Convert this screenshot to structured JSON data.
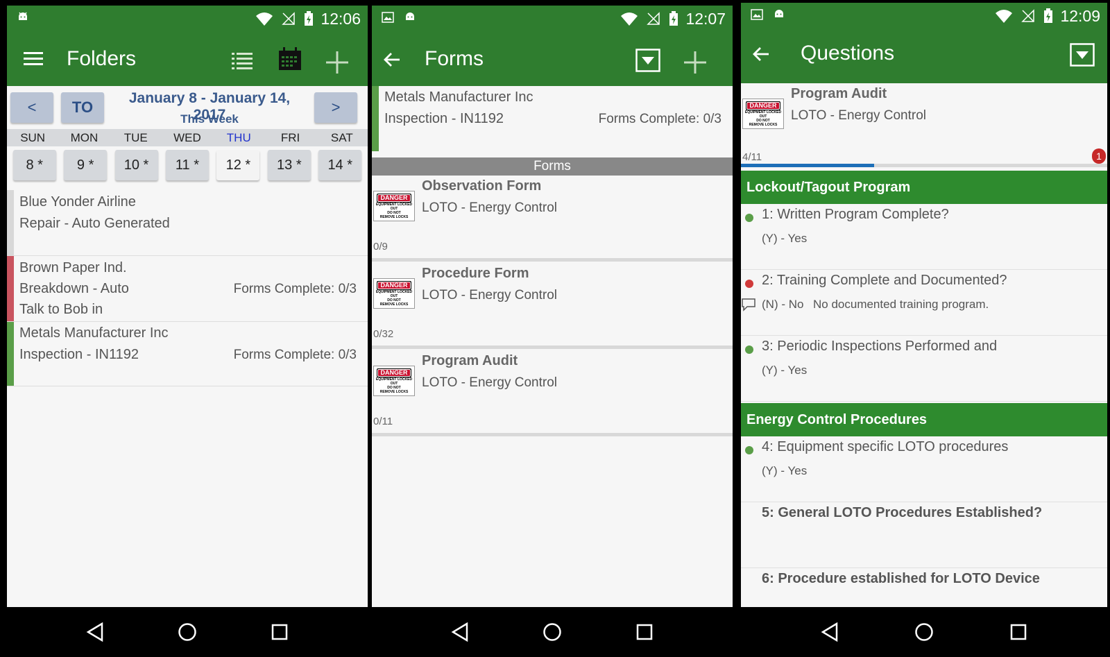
{
  "colors": {
    "primary": "#2f7d2f",
    "section": "#2e8b2e",
    "green_dot": "#5a9e48",
    "red_dot": "#d03a3a",
    "progress": "#1e6fb8"
  },
  "panel1": {
    "status_time": "12:06",
    "title": "Folders",
    "prev": "<",
    "today": "TO",
    "next": ">",
    "week_range": "January 8 - January 14, 2017",
    "week_label": "This Week",
    "days": [
      "SUN",
      "MON",
      "TUE",
      "WED",
      "THU",
      "FRI",
      "SAT"
    ],
    "dates": [
      "8 *",
      "9 *",
      "10 *",
      "11 *",
      "12 *",
      "13 *",
      "14 *"
    ],
    "folders": [
      {
        "line1": "Blue Yonder Airline",
        "line2": "Repair - Auto Generated",
        "line3": "",
        "right": ""
      },
      {
        "line1": "Brown Paper Ind.",
        "line2": "Breakdown - Auto",
        "line3": "Talk to Bob in",
        "right": "Forms Complete: 0/3"
      },
      {
        "line1": "Metals Manufacturer Inc",
        "line2": "Inspection - IN1192",
        "line3": "",
        "right": "Forms Complete: 0/3"
      }
    ]
  },
  "panel2": {
    "status_time": "12:07",
    "title": "Forms",
    "header_line1": "Metals Manufacturer Inc",
    "header_line2": "Inspection - IN1192",
    "header_right": "Forms Complete: 0/3",
    "section": "Forms",
    "forms": [
      {
        "title": "Observation Form",
        "sub": "LOTO - Energy Control",
        "count": "0/9"
      },
      {
        "title": "Procedure Form",
        "sub": "LOTO - Energy Control",
        "count": "0/32"
      },
      {
        "title": "Program Audit",
        "sub": "LOTO - Energy Control",
        "count": "0/11"
      }
    ],
    "danger_sign": {
      "badge": "DANGER",
      "line1": "EQUIPMENT LOCKED OUT",
      "line2": "DO NOT",
      "line3": "REMOVE LOCKS"
    }
  },
  "panel3": {
    "status_time": "12:09",
    "title": "Questions",
    "form_title": "Program Audit",
    "form_sub": "LOTO - Energy Control",
    "progress_label": "4/11",
    "progress_value": 0.364,
    "badge": "1",
    "sections": [
      "Lockout/Tagout Program",
      "Energy Control Procedures"
    ],
    "questions": [
      {
        "text": "1: Written Program Complete?",
        "answer": "(Y) - Yes",
        "note": ""
      },
      {
        "text": "2: Training Complete and Documented?",
        "answer": "(N) - No",
        "note": "No documented training program."
      },
      {
        "text": "3: Periodic Inspections Performed and",
        "answer": "(Y) - Yes",
        "note": ""
      },
      {
        "text": "4: Equipment specific LOTO procedures",
        "answer": "(Y) - Yes",
        "note": ""
      },
      {
        "text": "5: General LOTO Procedures Established?",
        "answer": "",
        "note": ""
      },
      {
        "text": "6: Procedure established for LOTO Device",
        "answer": "",
        "note": ""
      }
    ]
  }
}
